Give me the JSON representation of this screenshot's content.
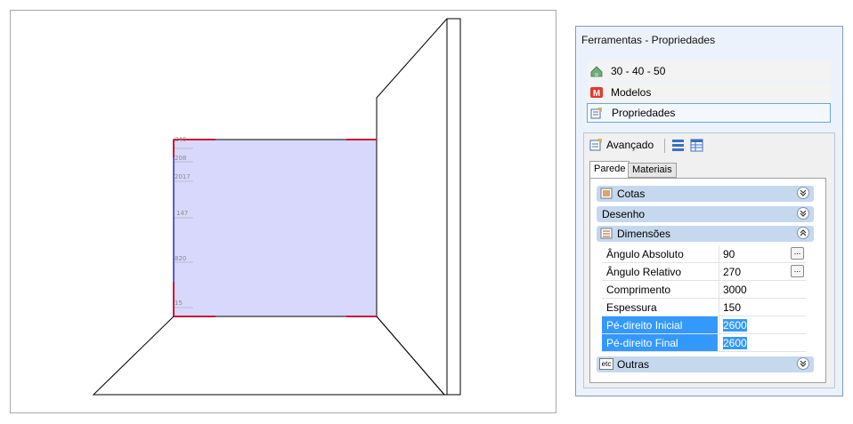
{
  "panel": {
    "title": "Ferramentas - Propriedades",
    "tools": [
      {
        "label": "30 - 40 - 50",
        "icon": "house-icon"
      },
      {
        "label": "Modelos",
        "icon": "models-m-icon"
      },
      {
        "label": "Propriedades",
        "icon": "properties-icon"
      }
    ],
    "advanced_label": "Avançado",
    "tabs": [
      "Parede",
      "Materiais"
    ],
    "categories": {
      "cotas": "Cotas",
      "desenho": "Desenho",
      "dimensoes": "Dimensões",
      "outras": "Outras",
      "outras_icon_text": "etc"
    },
    "properties": [
      {
        "name": "Ângulo Absoluto",
        "value": "90"
      },
      {
        "name": "Ângulo Relativo",
        "value": "270"
      },
      {
        "name": "Comprimento",
        "value": "3000"
      },
      {
        "name": "Espessura",
        "value": "150"
      },
      {
        "name": "Pé-direito Inicial",
        "value": "2600"
      },
      {
        "name": "Pé-direito Final",
        "value": "2600"
      }
    ],
    "ellipsis": "..."
  },
  "viewport": {
    "dim_labels": [
      "240",
      "208",
      "2017",
      "147",
      "820",
      "15"
    ]
  },
  "colors": {
    "wall_fill": "#d7d8fb",
    "selection": "#3399ff",
    "category_bar": "#c5d8ee",
    "panel_bg": "#ecf2fb"
  }
}
